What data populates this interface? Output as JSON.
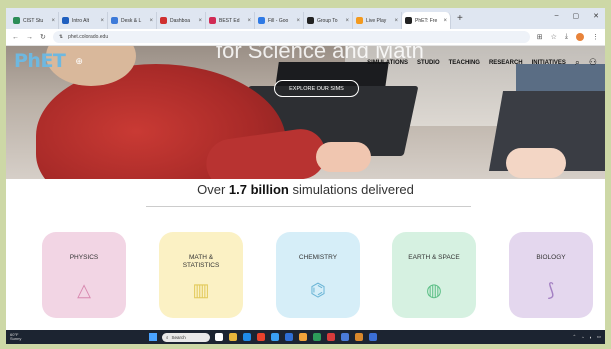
{
  "browser": {
    "tabs": [
      {
        "label": "CIST Stu",
        "color": "#2c8d57"
      },
      {
        "label": "Intro Alt",
        "color": "#1f5fbf"
      },
      {
        "label": "Desk & L",
        "color": "#3d7ad9"
      },
      {
        "label": "Dashboa",
        "color": "#cf2f2f"
      },
      {
        "label": "BEST Ed",
        "color": "#d12b55"
      },
      {
        "label": "Fill - Goo",
        "color": "#2f7ae5"
      },
      {
        "label": "Group To",
        "color": "#222"
      },
      {
        "label": "Live Play",
        "color": "#f39a1e"
      },
      {
        "label": "PhET: Fre",
        "color": "#222",
        "active": true
      }
    ],
    "url": "phet.colorado.edu",
    "window_controls": [
      "–",
      "▢",
      "✕"
    ]
  },
  "site": {
    "logo": "PhET",
    "hero_headline": "for Science and Math",
    "nav": [
      "SIMULATIONS",
      "STUDIO",
      "TEACHING",
      "RESEARCH",
      "INITIATIVES"
    ],
    "explore_button": "EXPLORE OUR SIMS",
    "stats": {
      "prefix": "Over ",
      "bold": "1.7 billion",
      "suffix": " simulations delivered"
    },
    "subjects": [
      {
        "label": "PHYSICS",
        "bg": "#f2d5e4",
        "icon": "△",
        "icon_color": "#d88ab0"
      },
      {
        "label": "MATH &\nSTATISTICS",
        "bg": "#fbf1c4",
        "icon": "▥",
        "icon_color": "#e2c95a"
      },
      {
        "label": "CHEMISTRY",
        "bg": "#d6eef8",
        "icon": "⌬",
        "icon_color": "#6bb5d6"
      },
      {
        "label": "EARTH & SPACE",
        "bg": "#d6f1e1",
        "icon": "◍",
        "icon_color": "#5cbf86"
      },
      {
        "label": "BIOLOGY",
        "bg": "#e4d7ee",
        "icon": "⟆",
        "icon_color": "#a481c3"
      }
    ]
  },
  "taskbar": {
    "weather": [
      "60°F",
      "Sunny"
    ],
    "search_placeholder": "Search",
    "icons": [
      {
        "color": "#ffffff"
      },
      {
        "color": "#e7b53b"
      },
      {
        "color": "#1f8be8"
      },
      {
        "color": "#e8422c"
      },
      {
        "color": "#3aa0f3"
      },
      {
        "color": "#2f6fd6"
      },
      {
        "color": "#f2a33a"
      },
      {
        "color": "#2d9c5a"
      },
      {
        "color": "#d83b3b"
      },
      {
        "color": "#4a7bd9"
      },
      {
        "color": "#d9882c"
      },
      {
        "color": "#3b6fd6"
      }
    ]
  }
}
